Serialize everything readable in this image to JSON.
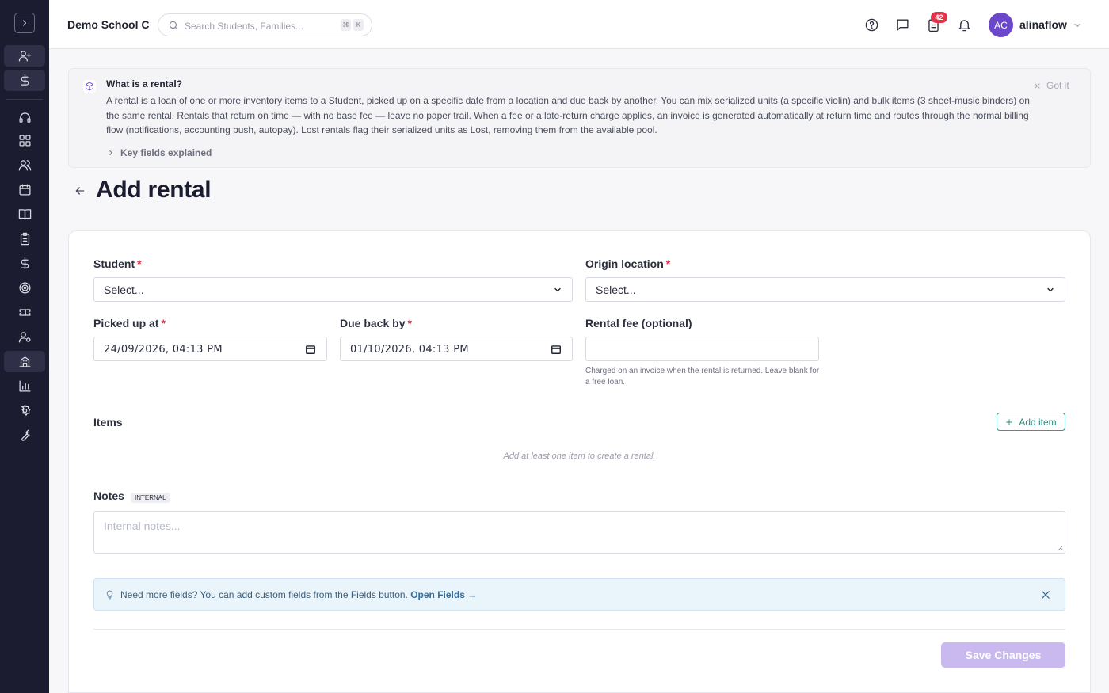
{
  "topbar": {
    "school_name": "Demo School C",
    "search_placeholder": "Search Students, Families...",
    "shortcut_mod": "⌘",
    "shortcut_key": "K",
    "notification_count": "42",
    "avatar_initials": "AC",
    "username": "alinaflow"
  },
  "info_banner": {
    "title": "What is a rental?",
    "text": "A rental is a loan of one or more inventory items to a Student, picked up on a specific date from a location and due back by another. You can mix serialized units (a specific violin) and bulk items (3 sheet-music binders) on the same rental. Rentals that return on time — with no base fee — leave no paper trail. When a fee or a late-return charge applies, an invoice is generated automatically at return time and routes through the normal billing flow (notifications, accounting push, autopay). Lost rentals flag their serialized units as Lost, removing them from the available pool.",
    "dismiss_label": "Got it",
    "expand_label": "Key fields explained"
  },
  "page": {
    "title": "Add rental"
  },
  "form": {
    "student_label": "Student",
    "student_value": "Select...",
    "origin_label": "Origin location",
    "origin_value": "Select...",
    "picked_up_label": "Picked up at",
    "picked_up_value": "24/09/2026, 04:13 PM",
    "due_back_label": "Due back by",
    "due_back_value": "01/10/2026, 04:13 PM",
    "rental_fee_label": "Rental fee (optional)",
    "rental_fee_value": "",
    "rental_fee_hint": "Charged on an invoice when the rental is returned. Leave blank for a free loan.",
    "required_mark": "*",
    "items_label": "Items",
    "add_item_label": "Add item",
    "items_empty": "Add at least one item to create a rental.",
    "notes_label": "Notes",
    "notes_tag": "INTERNAL",
    "notes_placeholder": "Internal notes...",
    "tip_text": "Need more fields? You can add custom fields from the Fields button.",
    "tip_link": "Open Fields →",
    "save_label": "Save Changes"
  },
  "sidebar": {
    "items": [
      "add-user",
      "billing",
      "support",
      "dashboard",
      "students",
      "calendar",
      "library",
      "attendance",
      "payments",
      "goals",
      "tickets",
      "staff",
      "inventory",
      "reports",
      "settings",
      "tools"
    ]
  },
  "colors": {
    "sidebar_bg": "#1b1c30",
    "accent_purple": "#6b47c9",
    "save_disabled": "#c9b9ef",
    "teal": "#2f8a7c",
    "required": "#e0344a"
  }
}
